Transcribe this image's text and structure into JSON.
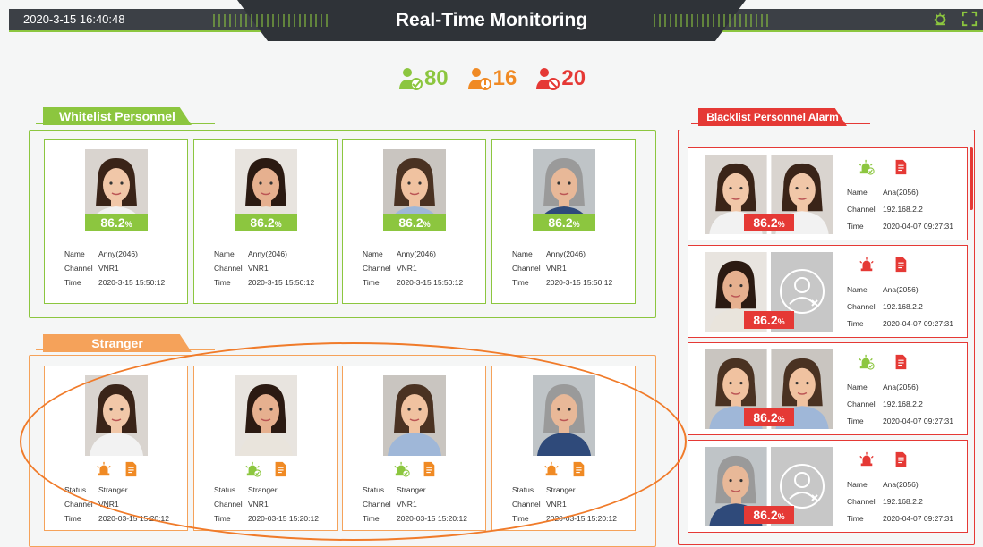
{
  "header": {
    "datetime": "2020-3-15  16:40:48",
    "title": "Real-Time Monitoring",
    "settings_icon": "gear-alert-icon",
    "fullscreen_icon": "fullscreen-icon"
  },
  "stats": {
    "whitelist_count": "80",
    "stranger_count": "16",
    "blacklist_count": "20"
  },
  "colors": {
    "green": "#8cc63f",
    "orange": "#f5a25a",
    "red": "#e53935",
    "header": "#3c4046"
  },
  "whitelist": {
    "title": "Whitelist Personnel",
    "cards": [
      {
        "score": "86.2",
        "unit": "%",
        "name_label": "Name",
        "name": "Anny(2046)",
        "channel_label": "Channel",
        "channel": "VNR1",
        "time_label": "Time",
        "time": "2020-3-15 15:50:12"
      },
      {
        "score": "86.2",
        "unit": "%",
        "name_label": "Name",
        "name": "Anny(2046)",
        "channel_label": "Channel",
        "channel": "VNR1",
        "time_label": "Time",
        "time": "2020-3-15 15:50:12"
      },
      {
        "score": "86.2",
        "unit": "%",
        "name_label": "Name",
        "name": "Anny(2046)",
        "channel_label": "Channel",
        "channel": "VNR1",
        "time_label": "Time",
        "time": "2020-3-15 15:50:12"
      },
      {
        "score": "86.2",
        "unit": "%",
        "name_label": "Name",
        "name": "Anny(2046)",
        "channel_label": "Channel",
        "channel": "VNR1",
        "time_label": "Time",
        "time": "2020-3-15 15:50:12"
      }
    ]
  },
  "stranger": {
    "title": "Stranger",
    "cards": [
      {
        "status_label": "Status",
        "status": "Stranger",
        "channel_label": "Channel",
        "channel": "VNR1",
        "time_label": "Time",
        "time": "2020-03-15 15:20:12",
        "alert_icon": "alarm-icon"
      },
      {
        "status_label": "Status",
        "status": "Stranger",
        "channel_label": "Channel",
        "channel": "VNR1",
        "time_label": "Time",
        "time": "2020-03-15 15:20:12",
        "alert_icon": "alarm-ok-icon"
      },
      {
        "status_label": "Status",
        "status": "Stranger",
        "channel_label": "Channel",
        "channel": "VNR1",
        "time_label": "Time",
        "time": "2020-03-15 15:20:12",
        "alert_icon": "alarm-ok-icon"
      },
      {
        "status_label": "Status",
        "status": "Stranger",
        "channel_label": "Channel",
        "channel": "VNR1",
        "time_label": "Time",
        "time": "2020-03-15 15:20:12",
        "alert_icon": "alarm-icon"
      }
    ]
  },
  "blacklist": {
    "title": "Blacklist Personnel Alarm",
    "cards": [
      {
        "score": "86.2",
        "unit": "%",
        "name_label": "Name",
        "name": "Ana(2056)",
        "channel_label": "Channel",
        "channel": "192.168.2.2",
        "time_label": "Time",
        "time": "2020-04-07 09:27:31",
        "alert_icon": "alarm-ok-icon"
      },
      {
        "score": "86.2",
        "unit": "%",
        "name_label": "Name",
        "name": "Ana(2056)",
        "channel_label": "Channel",
        "channel": "192.168.2.2",
        "time_label": "Time",
        "time": "2020-04-07 09:27:31",
        "alert_icon": "alarm-icon"
      },
      {
        "score": "86.2",
        "unit": "%",
        "name_label": "Name",
        "name": "Ana(2056)",
        "channel_label": "Channel",
        "channel": "192.168.2.2",
        "time_label": "Time",
        "time": "2020-04-07 09:27:31",
        "alert_icon": "alarm-ok-icon"
      },
      {
        "score": "86.2",
        "unit": "%",
        "name_label": "Name",
        "name": "Ana(2056)",
        "channel_label": "Channel",
        "channel": "192.168.2.2",
        "time_label": "Time",
        "time": "2020-04-07 09:27:31",
        "alert_icon": "alarm-icon"
      }
    ]
  }
}
